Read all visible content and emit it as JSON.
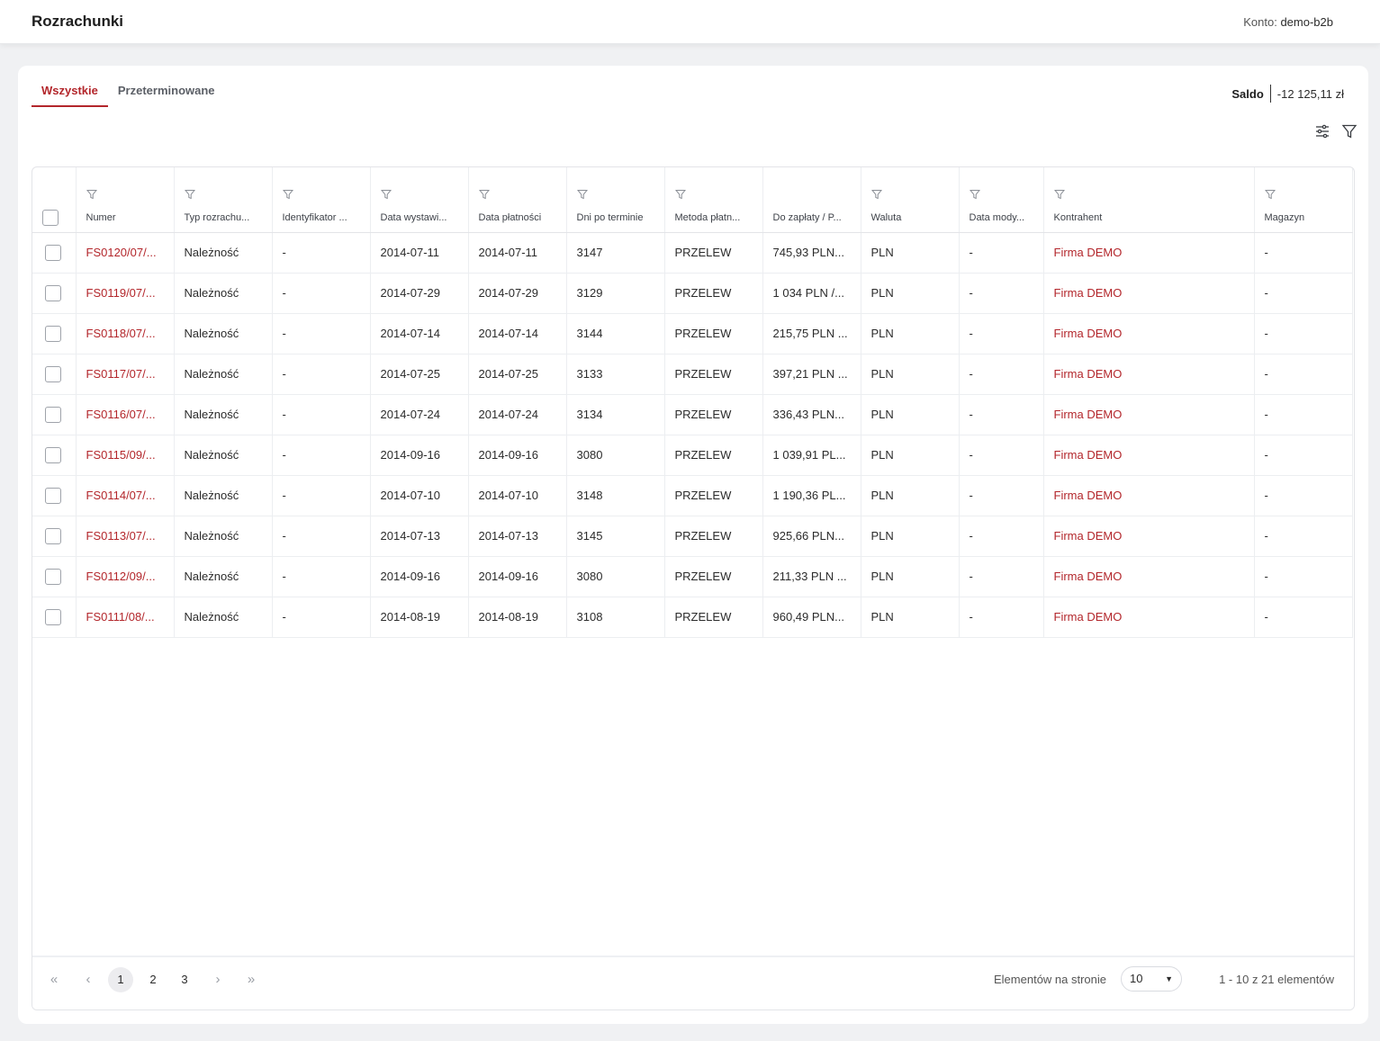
{
  "header": {
    "title": "Rozrachunki",
    "account_label": "Konto:",
    "account_value": "demo-b2b"
  },
  "tabs": [
    {
      "label": "Wszystkie",
      "active": true
    },
    {
      "label": "Przeterminowane",
      "active": false
    }
  ],
  "saldo": {
    "label": "Saldo",
    "value": "-12 125,11 zł"
  },
  "toolbar": {
    "icons": [
      "settings-sliders-icon",
      "filter-icon"
    ]
  },
  "table": {
    "columns": [
      "Numer",
      "Typ rozrachu...",
      "Identyfikator ...",
      "Data wystawi...",
      "Data płatności",
      "Dni po terminie",
      "Metoda płatn...",
      "Do zapłaty / P...",
      "Waluta",
      "Data mody...",
      "Kontrahent",
      "Magazyn"
    ],
    "rows": [
      [
        "FS0120/07/...",
        "Należność",
        "-",
        "2014-07-11",
        "2014-07-11",
        "3147",
        "PRZELEW",
        "745,93 PLN...",
        "PLN",
        "-",
        "Firma DEMO",
        "-"
      ],
      [
        "FS0119/07/...",
        "Należność",
        "-",
        "2014-07-29",
        "2014-07-29",
        "3129",
        "PRZELEW",
        "1 034 PLN /...",
        "PLN",
        "-",
        "Firma DEMO",
        "-"
      ],
      [
        "FS0118/07/...",
        "Należność",
        "-",
        "2014-07-14",
        "2014-07-14",
        "3144",
        "PRZELEW",
        "215,75 PLN ...",
        "PLN",
        "-",
        "Firma DEMO",
        "-"
      ],
      [
        "FS0117/07/...",
        "Należność",
        "-",
        "2014-07-25",
        "2014-07-25",
        "3133",
        "PRZELEW",
        "397,21 PLN ...",
        "PLN",
        "-",
        "Firma DEMO",
        "-"
      ],
      [
        "FS0116/07/...",
        "Należność",
        "-",
        "2014-07-24",
        "2014-07-24",
        "3134",
        "PRZELEW",
        "336,43 PLN...",
        "PLN",
        "-",
        "Firma DEMO",
        "-"
      ],
      [
        "FS0115/09/...",
        "Należność",
        "-",
        "2014-09-16",
        "2014-09-16",
        "3080",
        "PRZELEW",
        "1 039,91 PL...",
        "PLN",
        "-",
        "Firma DEMO",
        "-"
      ],
      [
        "FS0114/07/...",
        "Należność",
        "-",
        "2014-07-10",
        "2014-07-10",
        "3148",
        "PRZELEW",
        "1 190,36 PL...",
        "PLN",
        "-",
        "Firma DEMO",
        "-"
      ],
      [
        "FS0113/07/...",
        "Należność",
        "-",
        "2014-07-13",
        "2014-07-13",
        "3145",
        "PRZELEW",
        "925,66 PLN...",
        "PLN",
        "-",
        "Firma DEMO",
        "-"
      ],
      [
        "FS0112/09/...",
        "Należność",
        "-",
        "2014-09-16",
        "2014-09-16",
        "3080",
        "PRZELEW",
        "211,33 PLN ...",
        "PLN",
        "-",
        "Firma DEMO",
        "-"
      ],
      [
        "FS0111/08/...",
        "Należność",
        "-",
        "2014-08-19",
        "2014-08-19",
        "3108",
        "PRZELEW",
        "960,49 PLN...",
        "PLN",
        "-",
        "Firma DEMO",
        "-"
      ]
    ]
  },
  "pagination": {
    "first_icon": "double-chevron-left-icon",
    "prev_icon": "chevron-left-icon",
    "pages": [
      "1",
      "2",
      "3"
    ],
    "current": "1",
    "next_icon": "chevron-right-icon",
    "last_icon": "double-chevron-right-icon",
    "per_page_label": "Elementów na stronie",
    "per_page_value": "10",
    "range_text": "1 - 10 z 21 elementów"
  },
  "colors": {
    "accent": "#b3262b",
    "background": "#f0f1f3",
    "card": "#ffffff"
  }
}
